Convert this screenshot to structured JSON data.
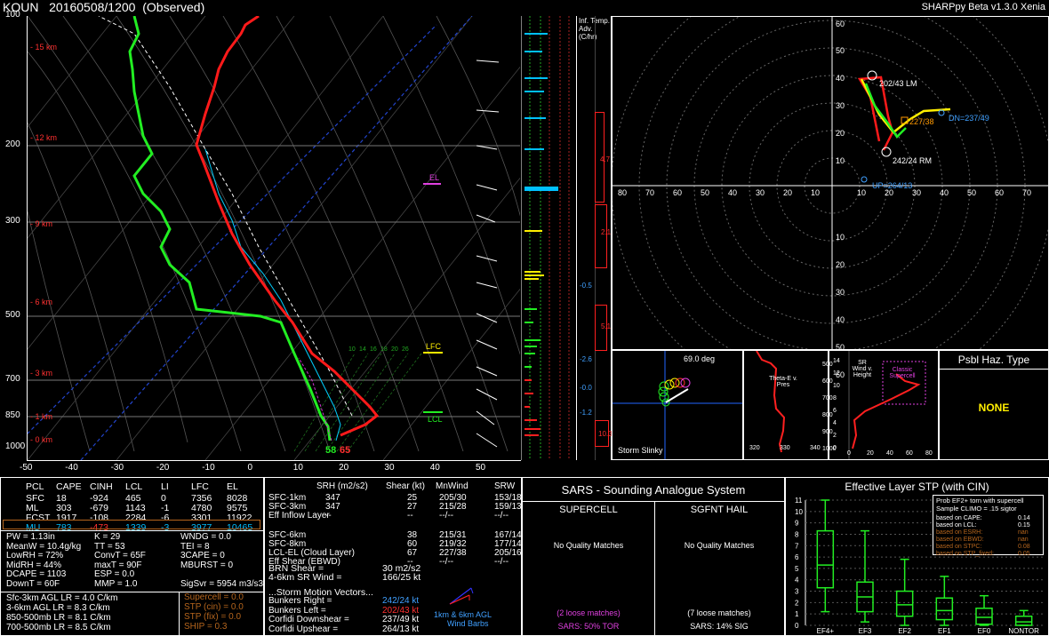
{
  "header": {
    "station": "KOUN",
    "datetime": "20160508/1200",
    "type": "(Observed)",
    "version": "SHARPpy Beta v1.3.0 Xenia"
  },
  "skewt": {
    "pressure_labels": [
      "100",
      "200",
      "300",
      "500",
      "700",
      "850",
      "1000"
    ],
    "height_labels": [
      "15 km",
      "12 km",
      "9 km",
      "6 km",
      "3 km",
      "1 km",
      "0 km"
    ],
    "temp_labels": [
      "-50",
      "-40",
      "-30",
      "-20",
      "-10",
      "0",
      "10",
      "20",
      "30",
      "40",
      "50"
    ],
    "mixing_labels": [
      "10",
      "14",
      "16",
      "18",
      "20",
      "26"
    ],
    "el_label": "EL",
    "lfc_label": "LFC",
    "lcl_label": "LCL",
    "sfc_td": "58",
    "sfc_t": "65"
  },
  "inferred_temp_adv": {
    "title": "Inf. Temp. Adv. (C/hr)",
    "values": [
      "4.7",
      "2.1",
      "-0.5",
      "5.1",
      "-2.6",
      "-0.0",
      "-1.2",
      "10.3"
    ]
  },
  "hodograph": {
    "ring_labels_top": [
      "60",
      "50",
      "40",
      "30",
      "20",
      "10"
    ],
    "ring_labels_bottom": [
      "10",
      "20",
      "30",
      "40",
      "50",
      "60"
    ],
    "ring_labels_left": [
      "80",
      "70",
      "60",
      "50",
      "40",
      "30",
      "20",
      "10"
    ],
    "ring_labels_right": [
      "10",
      "20",
      "30",
      "40",
      "50",
      "60",
      "70",
      "80"
    ],
    "lm_label": "202/43 LM",
    "rm_label": "242/24 RM",
    "dn_label": "DN=237/49",
    "up_label": "UP=264/13",
    "mean_label": "227/38"
  },
  "storm_slinky": {
    "angle": "69.0 deg",
    "title": "Storm Slinky"
  },
  "theta_e": {
    "title": "Theta-E v. Pres",
    "y_labels": [
      "500",
      "600",
      "700",
      "800",
      "900",
      "1000"
    ],
    "x_labels": [
      "320",
      "330",
      "340"
    ]
  },
  "srwind": {
    "title": "SR Wind v. Height",
    "classic": "Classic Supercell",
    "y_labels": [
      "14",
      "12",
      "10",
      "8",
      "6",
      "4",
      "2",
      "0"
    ],
    "x_labels": [
      "0",
      "20",
      "40",
      "60",
      "80"
    ]
  },
  "hazard": {
    "title": "Psbl Haz. Type",
    "value": "NONE"
  },
  "thermo": {
    "headers": [
      "PCL",
      "CAPE",
      "CINH",
      "LCL",
      "LI",
      "LFC",
      "EL"
    ],
    "rows": [
      [
        "SFC",
        "18",
        "-924",
        "465",
        "0",
        "7356",
        "8028"
      ],
      [
        "ML",
        "303",
        "-679",
        "1143",
        "-1",
        "4780",
        "9575"
      ],
      [
        "FCST",
        "1917",
        "-108",
        "2284",
        "-6",
        "3301",
        "11922"
      ],
      [
        "MU",
        "783",
        "-473",
        "1339",
        "-3",
        "3977",
        "10465"
      ]
    ],
    "indices_col1": [
      "PW = 1.13in",
      "MeanW = 10.4g/kg",
      "LowRH = 72%",
      "MidRH = 44%",
      "DCAPE = 1103",
      "DownT = 60F"
    ],
    "indices_col2": [
      "K = 29",
      "TT = 53",
      "ConvT = 65F",
      "maxT = 90F",
      "ESP = 0.0",
      "MMP = 1.0"
    ],
    "indices_col3": [
      "WNDG = 0.0",
      "TEI = 8",
      "3CAPE = 0",
      "MBURST = 0",
      "",
      "SigSvr = 5954 m3/s3"
    ],
    "lapse_rates": [
      "Sfc-3km AGL LR = 4.0 C/km",
      "3-6km AGL LR = 8.3 C/km",
      "850-500mb LR = 8.1 C/km",
      "700-500mb LR = 8.5 C/km"
    ],
    "composites": [
      "Supercell = 0.0",
      "STP (cin) = 0.0",
      "STP (fix) = 0.0",
      "SHIP = 0.3"
    ]
  },
  "kinematics": {
    "headers": [
      "SRH (m2/s2)",
      "Shear (kt)",
      "MnWind",
      "SRW"
    ],
    "rows": [
      [
        "SFC-1km",
        "347",
        "25",
        "205/30",
        "153/18"
      ],
      [
        "SFC-3km",
        "347",
        "27",
        "215/28",
        "159/13"
      ],
      [
        "Eff Inflow Layer",
        "--",
        "--",
        "--/--",
        "--/--"
      ],
      [
        "",
        "",
        "",
        "",
        ""
      ],
      [
        "SFC-6km",
        "",
        "38",
        "215/31",
        "167/14"
      ],
      [
        "SFC-8km",
        "",
        "60",
        "219/32",
        "177/14"
      ],
      [
        "LCL-EL (Cloud Layer)",
        "",
        "67",
        "227/38",
        "205/16"
      ],
      [
        "Eff Shear (EBWD)",
        "",
        "--",
        "--/--",
        "--/--"
      ]
    ],
    "brn_label": "BRN Shear =",
    "brn_value": "30 m2/s2",
    "srwind_label": "4-6km SR Wind =",
    "srwind_value": "166/25 kt",
    "motion_title": "...Storm Motion Vectors...",
    "motions": [
      {
        "label": "Bunkers Right =",
        "value": "242/24 kt"
      },
      {
        "label": "Bunkers Left =",
        "value": "202/43 kt"
      },
      {
        "label": "Corfidi Downshear =",
        "value": "237/49 kt"
      },
      {
        "label": "Corfidi Upshear =",
        "value": "264/13 kt"
      }
    ],
    "barbs_caption": [
      "1km & 6km AGL",
      "Wind Barbs"
    ]
  },
  "sars": {
    "title": "SARS - Sounding Analogue System",
    "supercell": {
      "title": "SUPERCELL",
      "match": "No Quality Matches",
      "loose": "(2 loose matches)",
      "result": "SARS: 50% TOR"
    },
    "hail": {
      "title": "SGFNT HAIL",
      "match": "No Quality Matches",
      "loose": "(7 loose matches)",
      "result": "SARS: 14% SIG"
    }
  },
  "stp": {
    "title": "Effective Layer STP (with CIN)",
    "y_labels": [
      "11",
      "10",
      "9",
      "8",
      "7",
      "6",
      "5",
      "4",
      "3",
      "2",
      "1",
      "0"
    ],
    "categories": [
      "EF4+",
      "EF3",
      "EF2",
      "EF1",
      "EF0",
      "NONTOR"
    ],
    "legend_title": "Prob EF2+ torn with supercell",
    "legend_sub": "Sample CLIMO = .15 sigtor",
    "legend_rows": [
      {
        "label": "based on CAPE:",
        "value": "0.14"
      },
      {
        "label": "based on LCL:",
        "value": "0.15"
      },
      {
        "label": "based on ESRH:",
        "value": "nan"
      },
      {
        "label": "based on EBWD:",
        "value": "nan"
      },
      {
        "label": "based on STPC:",
        "value": "0.08"
      },
      {
        "label": "based on STP_fixed:",
        "value": "0.05"
      }
    ]
  },
  "chart_data": {
    "type": "box",
    "title": "Effective Layer STP (with CIN)",
    "categories": [
      "EF4+",
      "EF3",
      "EF2",
      "EF1",
      "EF0",
      "NONTOR"
    ],
    "whisker_low": [
      1.2,
      0.3,
      0.0,
      0.0,
      0.0,
      0.0
    ],
    "q1": [
      3.3,
      1.2,
      0.8,
      0.5,
      0.1,
      0.0
    ],
    "median": [
      5.3,
      2.5,
      1.8,
      1.3,
      0.7,
      0.3
    ],
    "q3": [
      8.3,
      3.8,
      3.0,
      2.4,
      1.5,
      0.8
    ],
    "whisker_high": [
      11.0,
      8.3,
      5.8,
      4.3,
      2.6,
      1.3
    ],
    "ylim": [
      0,
      11
    ]
  }
}
